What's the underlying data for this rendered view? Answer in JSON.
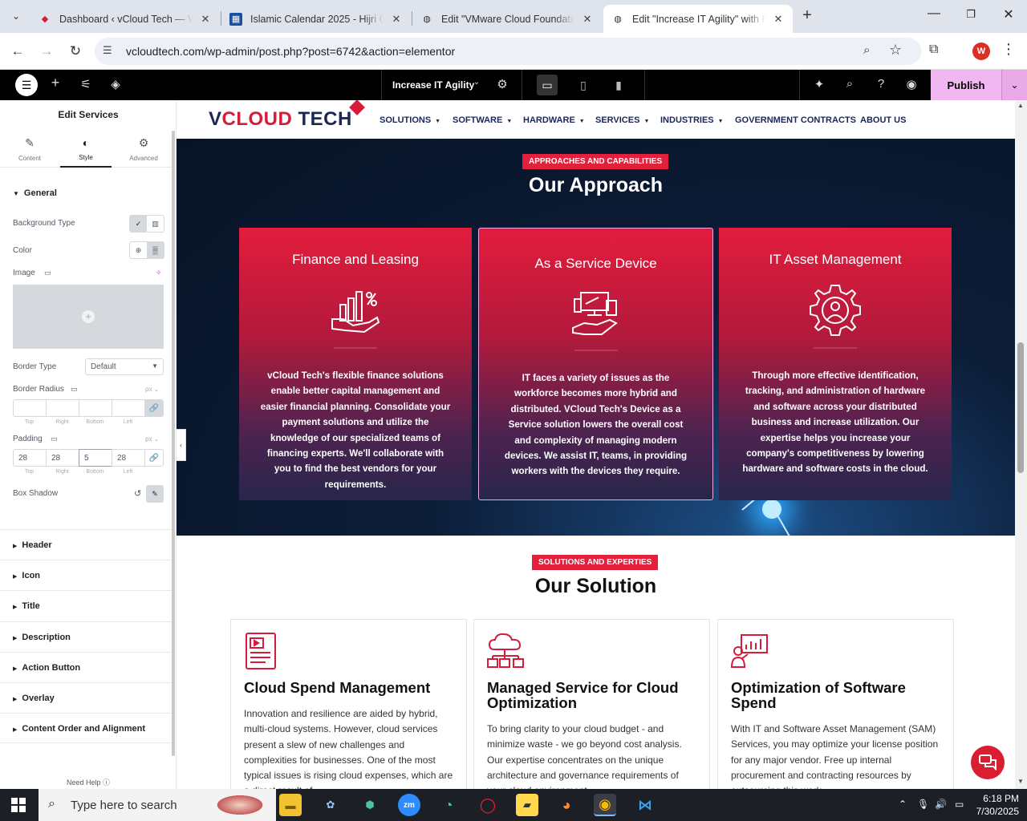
{
  "browser": {
    "tabs": [
      {
        "title": "Dashboard ‹ vCloud Tech — WordPress",
        "favicon": "vcloud-favicon",
        "active": false
      },
      {
        "title": "Islamic Calendar 2025 - Hijri Calendar",
        "favicon": "calendar-favicon",
        "active": false
      },
      {
        "title": "Edit \"VMware Cloud Foundation\"",
        "favicon": "globe-favicon",
        "active": false
      },
      {
        "title": "Edit \"Increase IT Agility\" with Elementor",
        "favicon": "globe-favicon",
        "active": true
      }
    ],
    "url": "vcloudtech.com/wp-admin/post.php?post=6742&action=elementor",
    "profile_initial": "W"
  },
  "elementor": {
    "page_name": "Increase IT Agility",
    "publish_label": "Publish"
  },
  "panel": {
    "title": "Edit Services",
    "tabs": [
      {
        "label": "Content",
        "icon": "pencil-icon"
      },
      {
        "label": "Style",
        "icon": "contrast-icon"
      },
      {
        "label": "Advanced",
        "icon": "gear-icon"
      }
    ],
    "general_label": "General",
    "background_type_label": "Background Type",
    "color_label": "Color",
    "image_label": "Image",
    "border_type_label": "Border Type",
    "border_type_value": "Default",
    "border_radius_label": "Border Radius",
    "padding_label": "Padding",
    "unit": "px",
    "dim_labels": [
      "Top",
      "Right",
      "Bottom",
      "Left"
    ],
    "border_radius_values": [
      "",
      "",
      "",
      ""
    ],
    "padding_values": [
      "28",
      "28",
      "5",
      "28"
    ],
    "box_shadow_label": "Box Shadow",
    "sections": [
      "Header",
      "Icon",
      "Title",
      "Description",
      "Action Button",
      "Overlay",
      "Content Order and Alignment"
    ],
    "need_help": "Need Help"
  },
  "site": {
    "logo": {
      "v": "V",
      "cloud": "CLOUD",
      "tech": " TECH"
    },
    "nav": [
      {
        "label": "SOLUTIONS",
        "dropdown": true
      },
      {
        "label": "SOFTWARE",
        "dropdown": true
      },
      {
        "label": "HARDWARE",
        "dropdown": true
      },
      {
        "label": "SERVICES",
        "dropdown": true
      },
      {
        "label": "INDUSTRIES",
        "dropdown": true
      },
      {
        "label": "GOVERNMENT CONTRACTS",
        "dropdown": false
      },
      {
        "label": "ABOUT US",
        "dropdown": false
      }
    ],
    "approach": {
      "badge": "APPROACHES AND CAPABILITIES",
      "title": "Our Approach",
      "cards": [
        {
          "title": "Finance and Leasing",
          "icon": "finance-chart-hand-icon",
          "text": "vCloud Tech's flexible finance solutions enable better capital management and easier financial planning. Consolidate your payment solutions and utilize the knowledge of our specialized teams of financing experts. We'll collaborate with you to find the best vendors for your requirements."
        },
        {
          "title": "As a Service Device",
          "icon": "devices-hand-icon",
          "text": "IT faces a variety of issues as the workforce becomes more hybrid and distributed. VCloud Tech's Device as a Service solution lowers the overall cost and complexity of managing modern devices. We assist IT, teams, in providing workers with the devices they require."
        },
        {
          "title": "IT Asset Management",
          "icon": "gear-person-icon",
          "text": "Through more effective identification, tracking, and administration of hardware and software across your distributed business and increase utilization. Our expertise helps you increase your company's competitiveness by lowering hardware and software costs in the cloud."
        }
      ]
    },
    "solution": {
      "badge": "SOLUTIONS AND EXPERTIES",
      "title": "Our Solution",
      "cards": [
        {
          "title": "Cloud Spend Management",
          "icon": "tablet-video-icon",
          "text": "Innovation and resilience are aided by hybrid, multi-cloud systems. However, cloud services present a slew of new challenges and complexities for businesses. One of the most typical issues is rising cloud expenses, which are a direct result of"
        },
        {
          "title": "Managed Service for Cloud Optimization",
          "icon": "cloud-network-icon",
          "text": "To bring clarity to your cloud budget - and minimize waste - we go beyond cost analysis. Our expertise concentrates on the unique architecture and governance requirements of your cloud environment"
        },
        {
          "title": "Optimization of Software Spend",
          "icon": "analytics-person-icon",
          "text": "With IT and Software Asset Management (SAM) Services, you may optimize your license position for any major vendor. Free up internal procurement and contracting resources by outsourcing this work"
        }
      ]
    }
  },
  "taskbar": {
    "search_placeholder": "Type here to search",
    "time": "6:18 PM",
    "date": "7/30/2025"
  },
  "colors": {
    "brand_red": "#e3203c",
    "brand_navy": "#1b2757",
    "publish_pink": "#f0b7f0"
  }
}
